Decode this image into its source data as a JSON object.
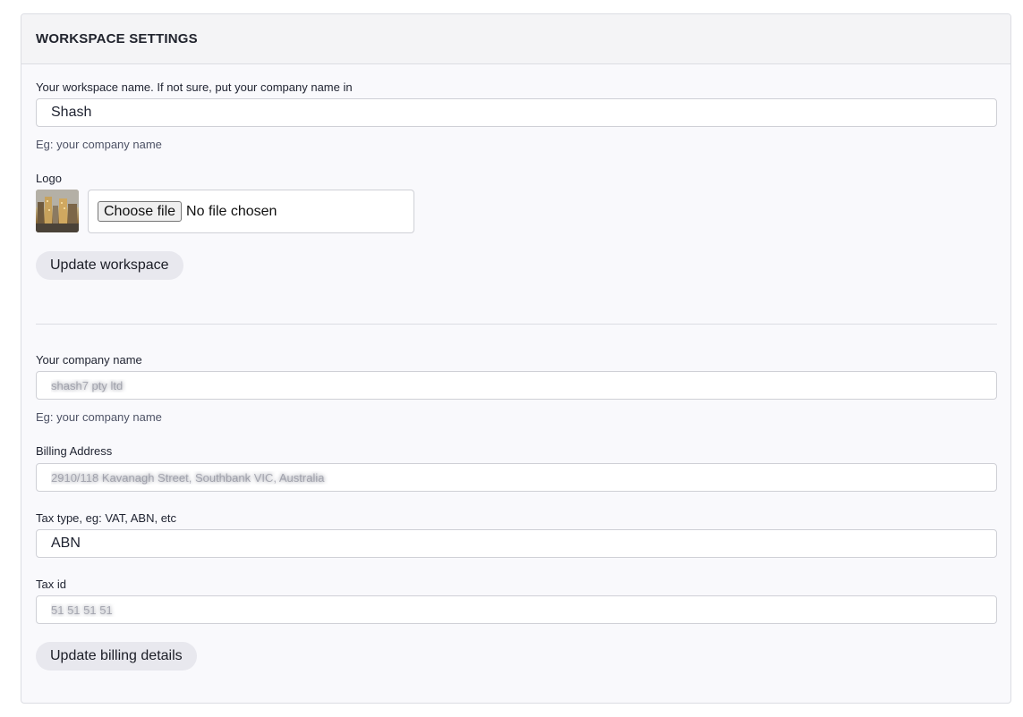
{
  "header": {
    "title": "WORKSPACE SETTINGS"
  },
  "workspace": {
    "name_label": "Your workspace name. If not sure, put your company name in",
    "name_value": "Shash",
    "name_help": "Eg: your company name",
    "logo_label": "Logo",
    "choose_file_label": "Choose file",
    "file_status": "No file chosen",
    "update_button": "Update workspace"
  },
  "billing": {
    "company_label": "Your company name",
    "company_value": "shash7 pty ltd",
    "company_help": "Eg: your company name",
    "address_label": "Billing Address",
    "address_value": "2910/118 Kavanagh Street, Southbank VIC, Australia",
    "tax_type_label": "Tax type, eg: VAT, ABN, etc",
    "tax_type_value": "ABN",
    "tax_id_label": "Tax id",
    "tax_id_value": "51 51 51 51",
    "update_button": "Update billing details"
  }
}
